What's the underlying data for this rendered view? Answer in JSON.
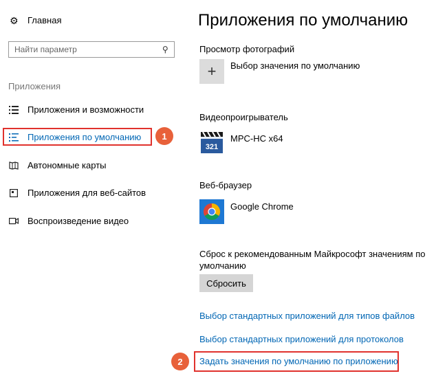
{
  "sidebar": {
    "home_label": "Главная",
    "search_placeholder": "Найти параметр",
    "section_label": "Приложения",
    "items": [
      {
        "label": "Приложения и возможности"
      },
      {
        "label": "Приложения по умолчанию"
      },
      {
        "label": "Автономные карты"
      },
      {
        "label": "Приложения для веб-сайтов"
      },
      {
        "label": "Воспроизведение видео"
      }
    ],
    "active_index": 1
  },
  "annotations": {
    "badge1": "1",
    "badge2": "2",
    "accent_color": "#e0312c",
    "badge_color": "#e8613a"
  },
  "main": {
    "title": "Приложения по умолчанию",
    "sections": [
      {
        "heading": "Просмотр фотографий",
        "app": "Выбор значения по умолчанию",
        "icon": "plus-icon"
      },
      {
        "heading": "Видеопроигрыватель",
        "app": "MPC-HC x64",
        "icon": "mpc-hc-icon"
      },
      {
        "heading": "Веб-браузер",
        "app": "Google Chrome",
        "icon": "chrome-icon"
      }
    ],
    "reset": {
      "text_line1": "Сброс к рекомендованным Майкрософт значениям по",
      "text_line2": "умолчанию",
      "button": "Сбросить"
    },
    "links": [
      "Выбор стандартных приложений для типов файлов",
      "Выбор стандартных приложений для протоколов",
      "Задать значения по умолчанию по приложению"
    ],
    "link_color": "#0066b4"
  }
}
